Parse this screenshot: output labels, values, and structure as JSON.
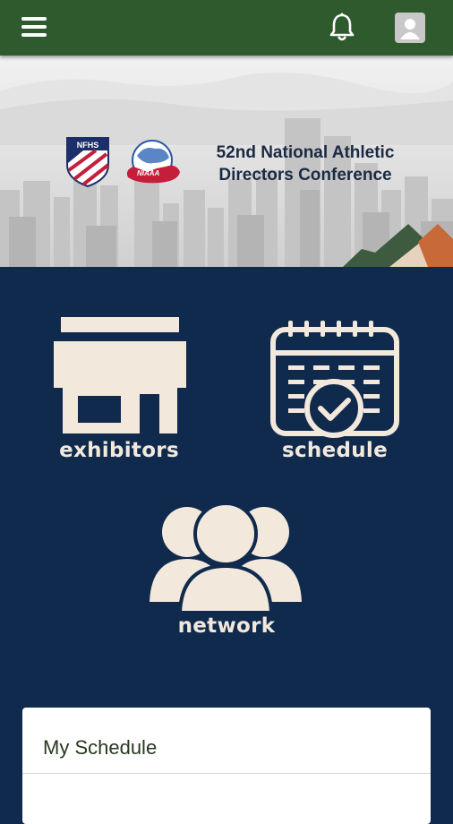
{
  "header": {
    "menu_icon": "hamburger-menu-icon",
    "notification_icon": "bell-icon",
    "profile_icon": "user-avatar-icon"
  },
  "banner": {
    "logo_left": "NFHS",
    "title_line1": "52nd National Athletic",
    "title_line2": "Directors Conference"
  },
  "tiles": {
    "exhibitors": "exhibitors",
    "schedule": "schedule",
    "network": "network"
  },
  "my_schedule": {
    "title": "My Schedule"
  },
  "colors": {
    "header_bg": "#2f5a2e",
    "nav_bg": "#0f2a4d",
    "icon_fill": "#f3e8dc"
  }
}
